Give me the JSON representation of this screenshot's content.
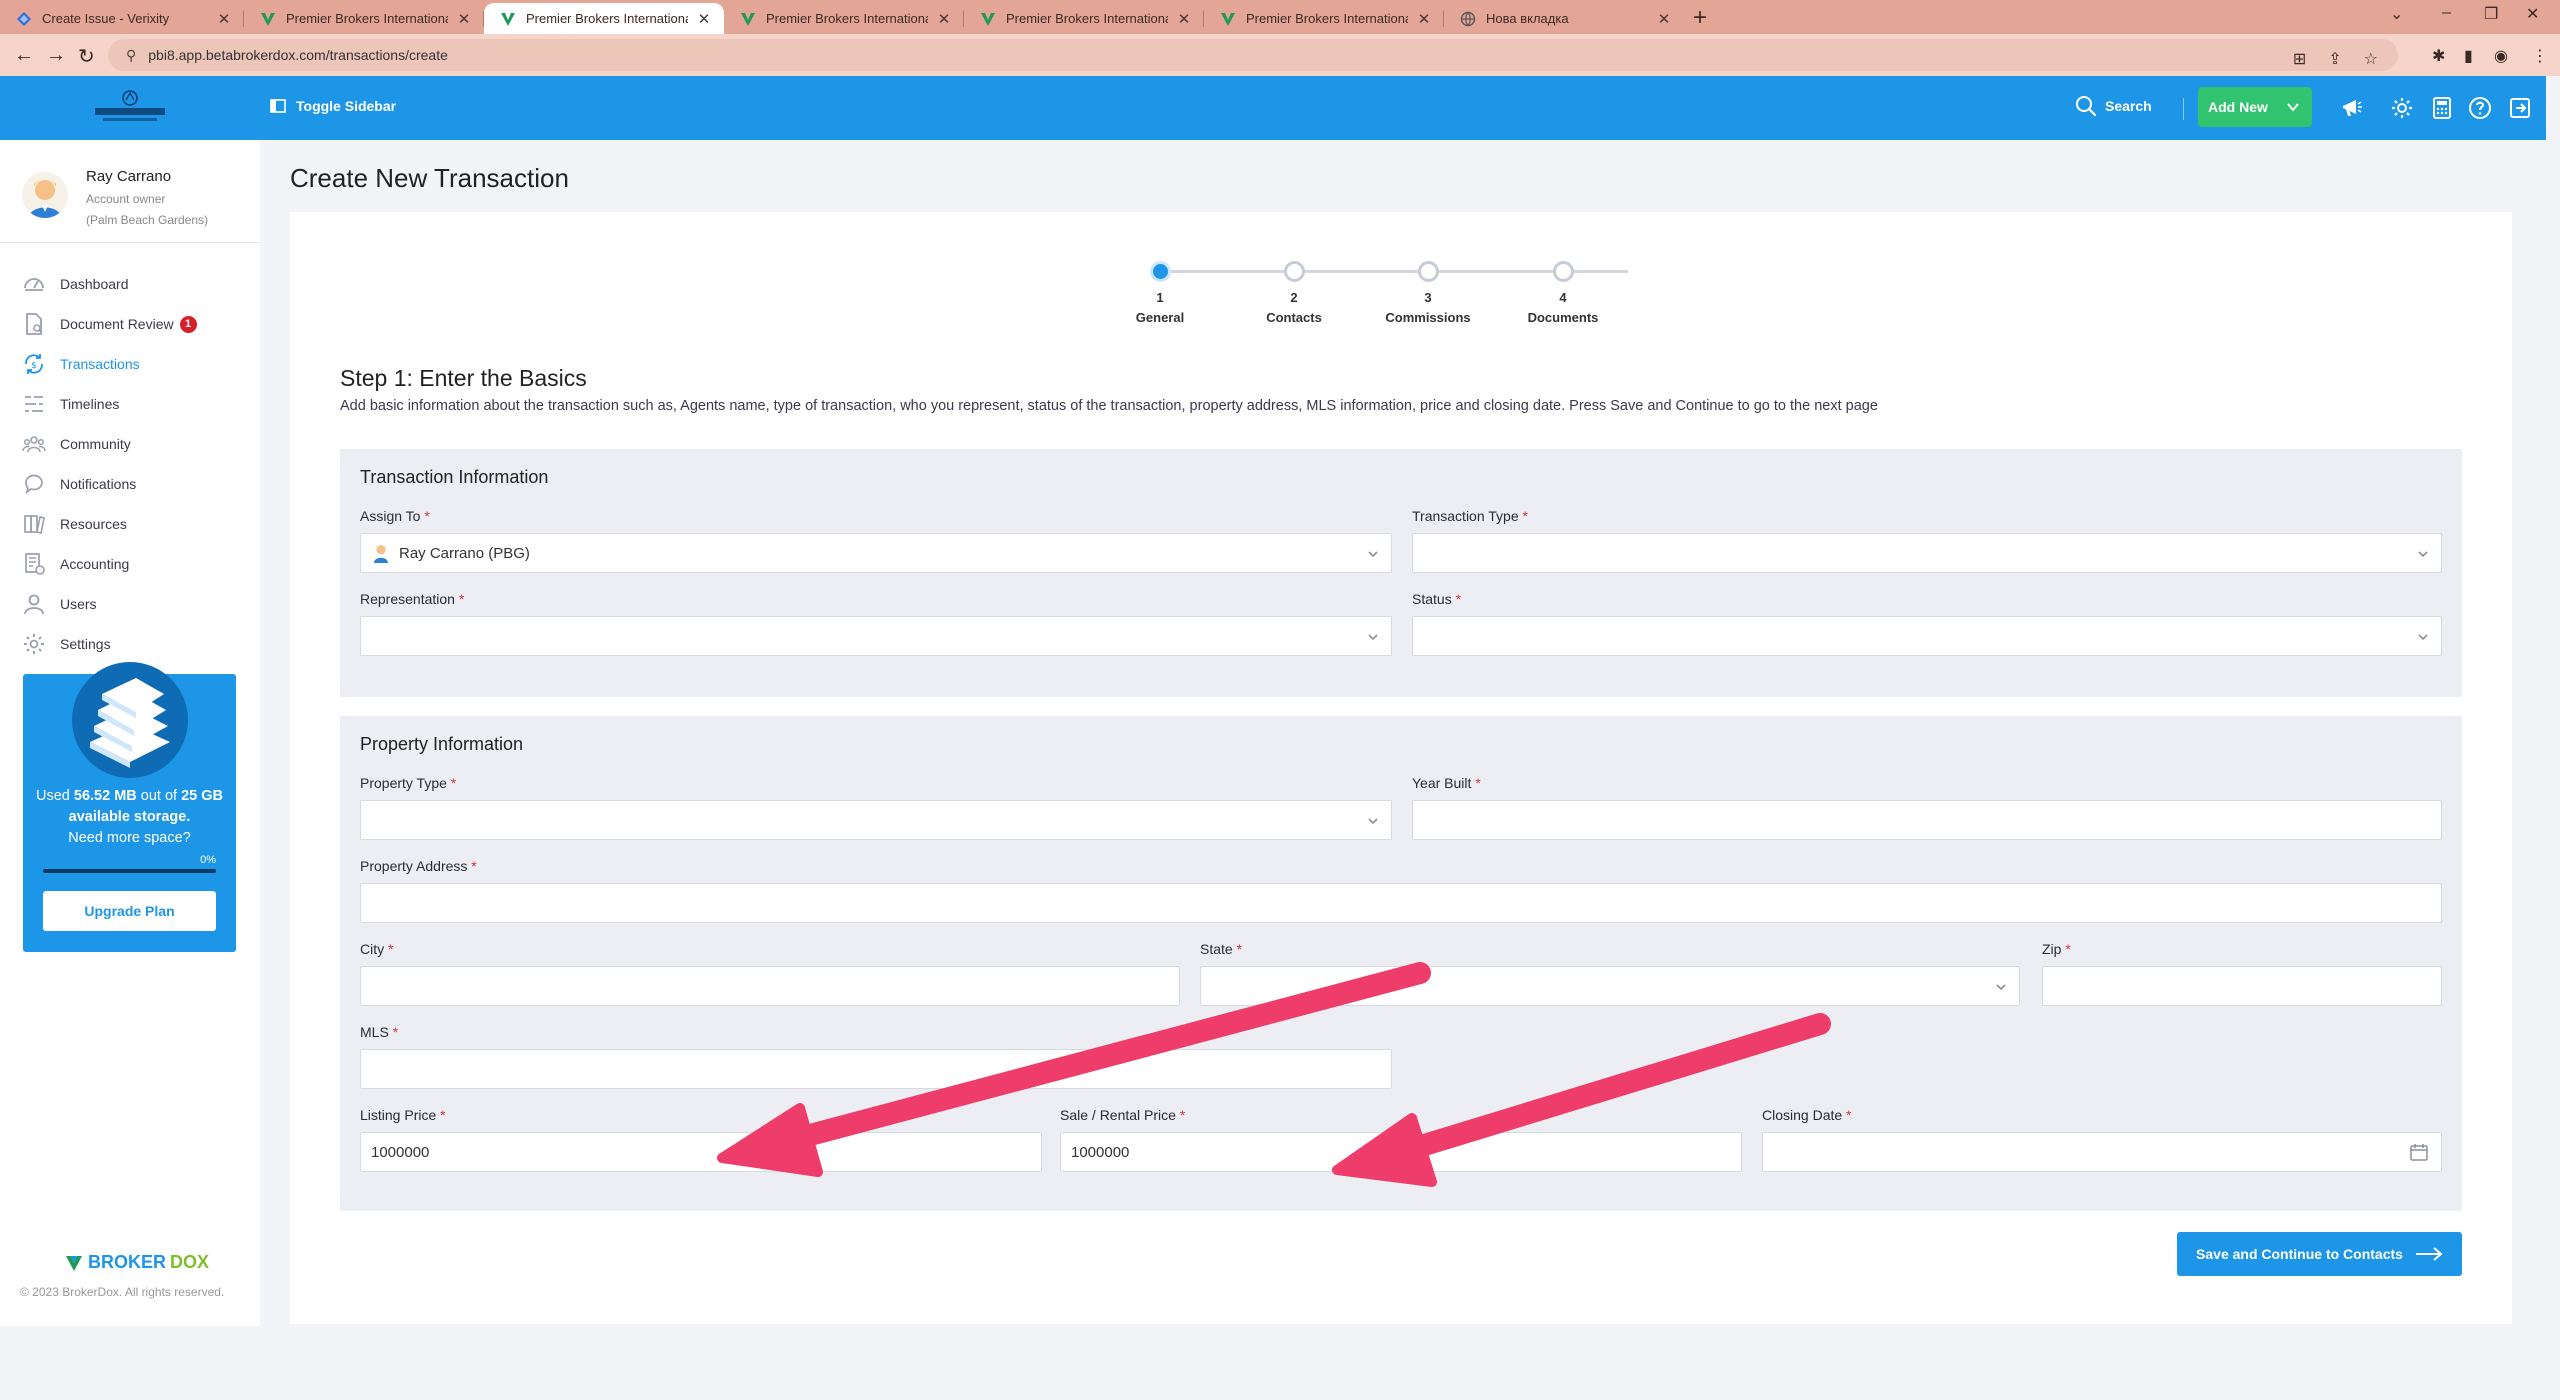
{
  "browser": {
    "tabs": [
      {
        "title": "Create Issue - Verixity",
        "favicon": "verixity-icon"
      },
      {
        "title": "Premier Brokers International Br",
        "favicon": "brokerdox-icon"
      },
      {
        "title": "Premier Brokers International Br",
        "favicon": "brokerdox-icon",
        "active": true
      },
      {
        "title": "Premier Brokers International Br",
        "favicon": "brokerdox-icon"
      },
      {
        "title": "Premier Brokers International Br",
        "favicon": "brokerdox-icon"
      },
      {
        "title": "Premier Brokers International Br",
        "favicon": "brokerdox-icon"
      },
      {
        "title": "Нова вкладка",
        "favicon": "globe-icon"
      }
    ],
    "url": "pbi8.app.betabrokerdox.com/transactions/create"
  },
  "header": {
    "toggle_sidebar": "Toggle Sidebar",
    "search": "Search",
    "add_new": "Add New",
    "brand_color": "#1d96e8",
    "accent_green": "#31c36f"
  },
  "user": {
    "name": "Ray Carrano",
    "role": "Account owner",
    "office": "(Palm Beach Gardens)"
  },
  "sidebar": {
    "items": [
      {
        "label": "Dashboard",
        "icon": "dashboard-icon"
      },
      {
        "label": "Document Review",
        "icon": "document-icon",
        "badge": "1"
      },
      {
        "label": "Transactions",
        "icon": "transactions-icon",
        "active": true
      },
      {
        "label": "Timelines",
        "icon": "timeline-icon"
      },
      {
        "label": "Community",
        "icon": "community-icon"
      },
      {
        "label": "Notifications",
        "icon": "notifications-icon"
      },
      {
        "label": "Resources",
        "icon": "resources-icon"
      },
      {
        "label": "Accounting",
        "icon": "accounting-icon"
      },
      {
        "label": "Users",
        "icon": "users-icon"
      },
      {
        "label": "Settings",
        "icon": "settings-icon"
      }
    ],
    "storage": {
      "used_prefix": "Used",
      "used": "56.52 MB",
      "out_of": "out of",
      "total": "25",
      "unit_text": "GB available storage.",
      "need_more": "Need more space?",
      "percent": "0%",
      "fill_fraction": 0.0,
      "upgrade": "Upgrade Plan"
    },
    "footer_logo_a": "BROKER",
    "footer_logo_b": "DOX",
    "copyright": "© 2023 BrokerDox. All rights reserved."
  },
  "page": {
    "title": "Create New Transaction",
    "steps": [
      {
        "num": "1",
        "label": "General",
        "active": true
      },
      {
        "num": "2",
        "label": "Contacts"
      },
      {
        "num": "3",
        "label": "Commissions"
      },
      {
        "num": "4",
        "label": "Documents"
      }
    ],
    "step_title": "Step 1: Enter the Basics",
    "step_desc": "Add basic information about the transaction such as, Agents name, type of transaction, who you represent, status of the transaction, property address, MLS information, price and closing date. Press Save and Continue to go to the next page"
  },
  "transaction_info": {
    "title": "Transaction Information",
    "assign_to": {
      "label": "Assign To",
      "value": "Ray Carrano (PBG)"
    },
    "transaction_type": {
      "label": "Transaction Type",
      "value": ""
    },
    "representation": {
      "label": "Representation",
      "value": ""
    },
    "status": {
      "label": "Status",
      "value": ""
    }
  },
  "property_info": {
    "title": "Property Information",
    "property_type": {
      "label": "Property Type",
      "value": ""
    },
    "year_built": {
      "label": "Year Built",
      "value": ""
    },
    "property_address": {
      "label": "Property Address",
      "value": ""
    },
    "city": {
      "label": "City",
      "value": ""
    },
    "state": {
      "label": "State",
      "value": ""
    },
    "zip": {
      "label": "Zip",
      "value": ""
    },
    "mls": {
      "label": "MLS",
      "value": ""
    },
    "listing_price": {
      "label": "Listing Price",
      "value": "1000000"
    },
    "sale_price": {
      "label": "Sale / Rental Price",
      "value": "1000000"
    },
    "closing_date": {
      "label": "Closing Date",
      "value": ""
    }
  },
  "required_marker": "*",
  "save_button": "Save and Continue to Contacts",
  "annotation_color": "#ee3d6a"
}
